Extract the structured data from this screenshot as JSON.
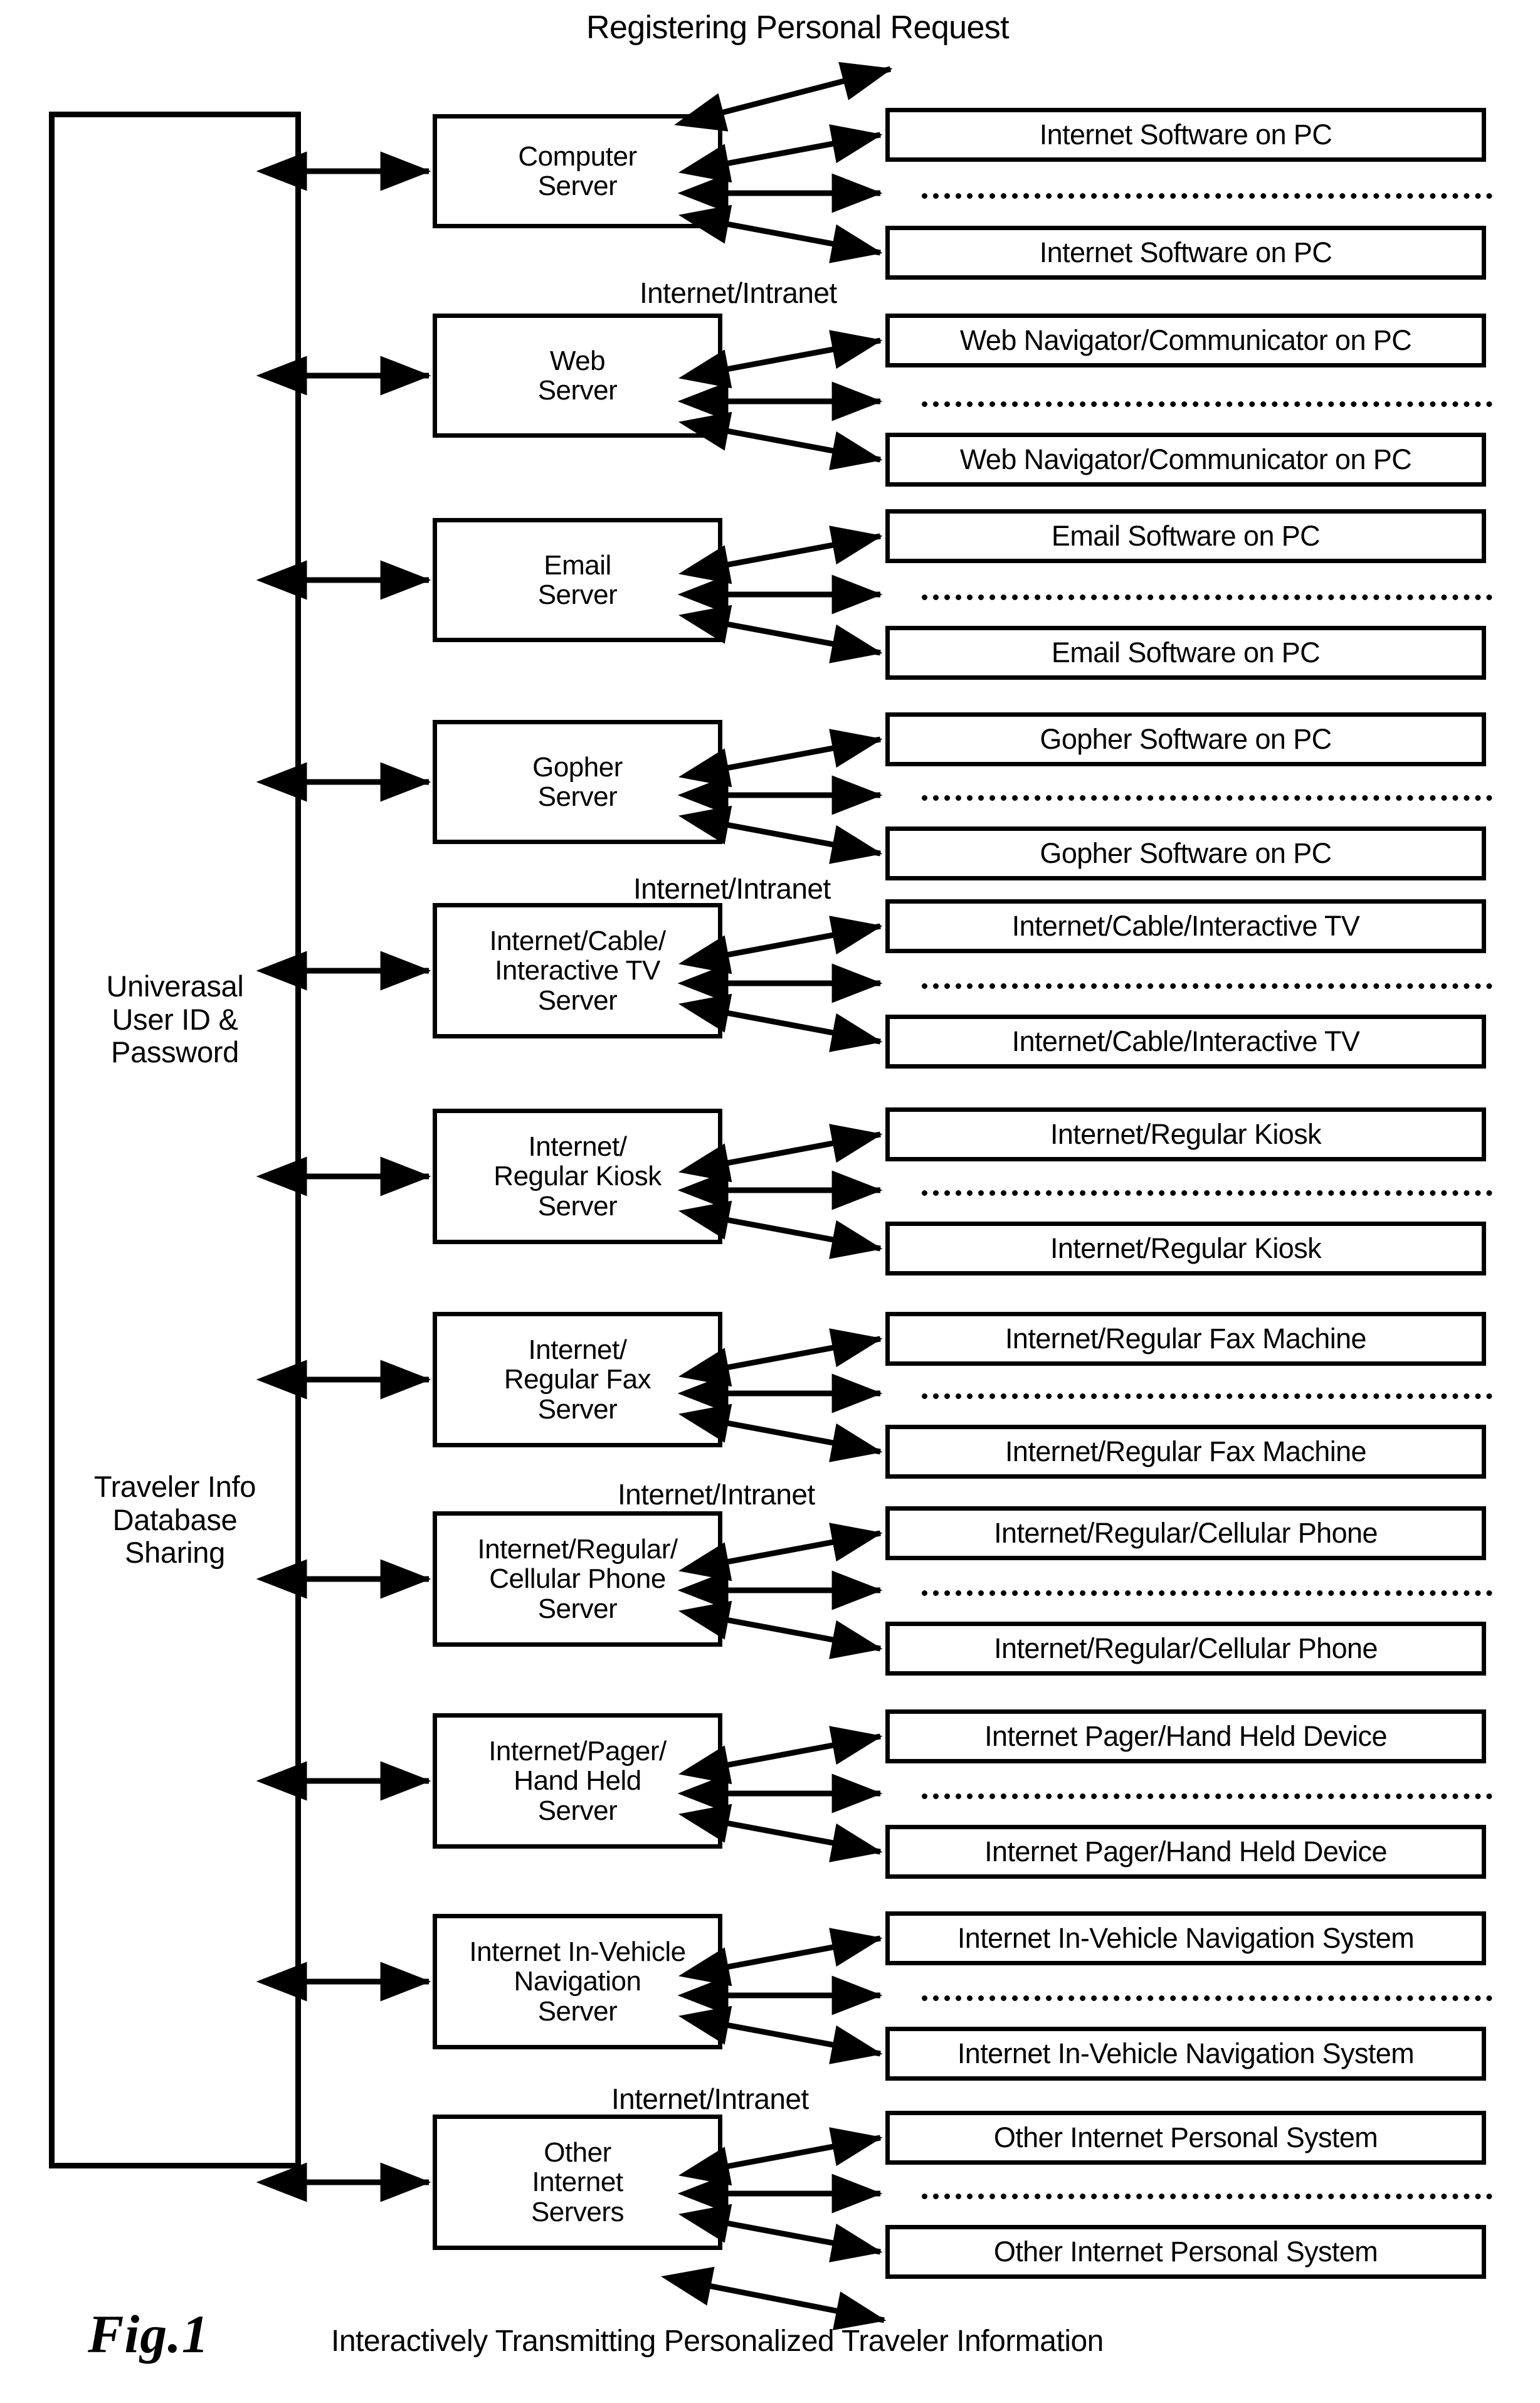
{
  "figure": {
    "number": "Fig.1",
    "caption": "Interactively Transmitting Personalized Traveler Information",
    "top_label": "Registering Personal Request",
    "network_label": "Internet/Intranet"
  },
  "left_column": {
    "label_top": "Univerasal\nUser ID &\nPassword",
    "label_top_lines": [
      "Univerasal",
      "User ID &",
      "Password"
    ],
    "label_bottom_lines": [
      "Traveler Info",
      "Database",
      "Sharing"
    ]
  },
  "rows": [
    {
      "server": "Computer\nServer",
      "server_lines": [
        "Computer",
        "Server"
      ],
      "device_top": "Internet Software on PC",
      "device_bottom": "Internet Software on PC",
      "network_label_above": false
    },
    {
      "server": "Web\nServer",
      "server_lines": [
        "Web",
        "Server"
      ],
      "device_top": "Web Navigator/Communicator on PC",
      "device_bottom": "Web Navigator/Communicator on PC",
      "network_label_above": true
    },
    {
      "server": "Email\nServer",
      "server_lines": [
        "Email",
        "Server"
      ],
      "device_top": "Email Software on PC",
      "device_bottom": "Email Software on PC",
      "network_label_above": false
    },
    {
      "server": "Gopher\nServer",
      "server_lines": [
        "Gopher",
        "Server"
      ],
      "device_top": "Gopher Software on PC",
      "device_bottom": "Gopher Software on PC",
      "network_label_above": false
    },
    {
      "server": "Internet/Cable/\nInteractive TV\nServer",
      "server_lines": [
        "Internet/Cable/",
        "Interactive TV",
        "Server"
      ],
      "device_top": "Internet/Cable/Interactive TV",
      "device_bottom": "Internet/Cable/Interactive TV",
      "network_label_above": true
    },
    {
      "server": "Internet/\nRegular Kiosk\nServer",
      "server_lines": [
        "Internet/",
        "Regular Kiosk",
        "Server"
      ],
      "device_top": "Internet/Regular Kiosk",
      "device_bottom": "Internet/Regular Kiosk",
      "network_label_above": false
    },
    {
      "server": "Internet/\nRegular Fax\nServer",
      "server_lines": [
        "Internet/",
        "Regular Fax",
        "Server"
      ],
      "device_top": "Internet/Regular Fax Machine",
      "device_bottom": "Internet/Regular Fax Machine",
      "network_label_above": false
    },
    {
      "server": "Internet/Regular/\nCellular Phone\nServer",
      "server_lines": [
        "Internet/Regular/",
        "Cellular Phone",
        "Server"
      ],
      "device_top": "Internet/Regular/Cellular Phone",
      "device_bottom": "Internet/Regular/Cellular Phone",
      "network_label_above": true
    },
    {
      "server": "Internet/Pager/\nHand Held\nServer",
      "server_lines": [
        "Internet/Pager/",
        "Hand Held",
        "Server"
      ],
      "device_top": "Internet Pager/Hand Held Device",
      "device_bottom": "Internet Pager/Hand Held Device",
      "network_label_above": false
    },
    {
      "server": "Internet In-Vehicle\nNavigation\nServer",
      "server_lines": [
        "Internet In-Vehicle",
        "Navigation",
        "Server"
      ],
      "device_top": "Internet In-Vehicle Navigation System",
      "device_bottom": "Internet In-Vehicle Navigation System",
      "network_label_above": false
    },
    {
      "server": "Other\nInternet\nServers",
      "server_lines": [
        "Other",
        "Internet",
        "Servers"
      ],
      "device_top": "Other Internet Personal System",
      "device_bottom": "Other Internet Personal System",
      "network_label_above": true
    }
  ],
  "colors": {
    "line": "#000000",
    "background": "#ffffff",
    "text": "#000000"
  }
}
